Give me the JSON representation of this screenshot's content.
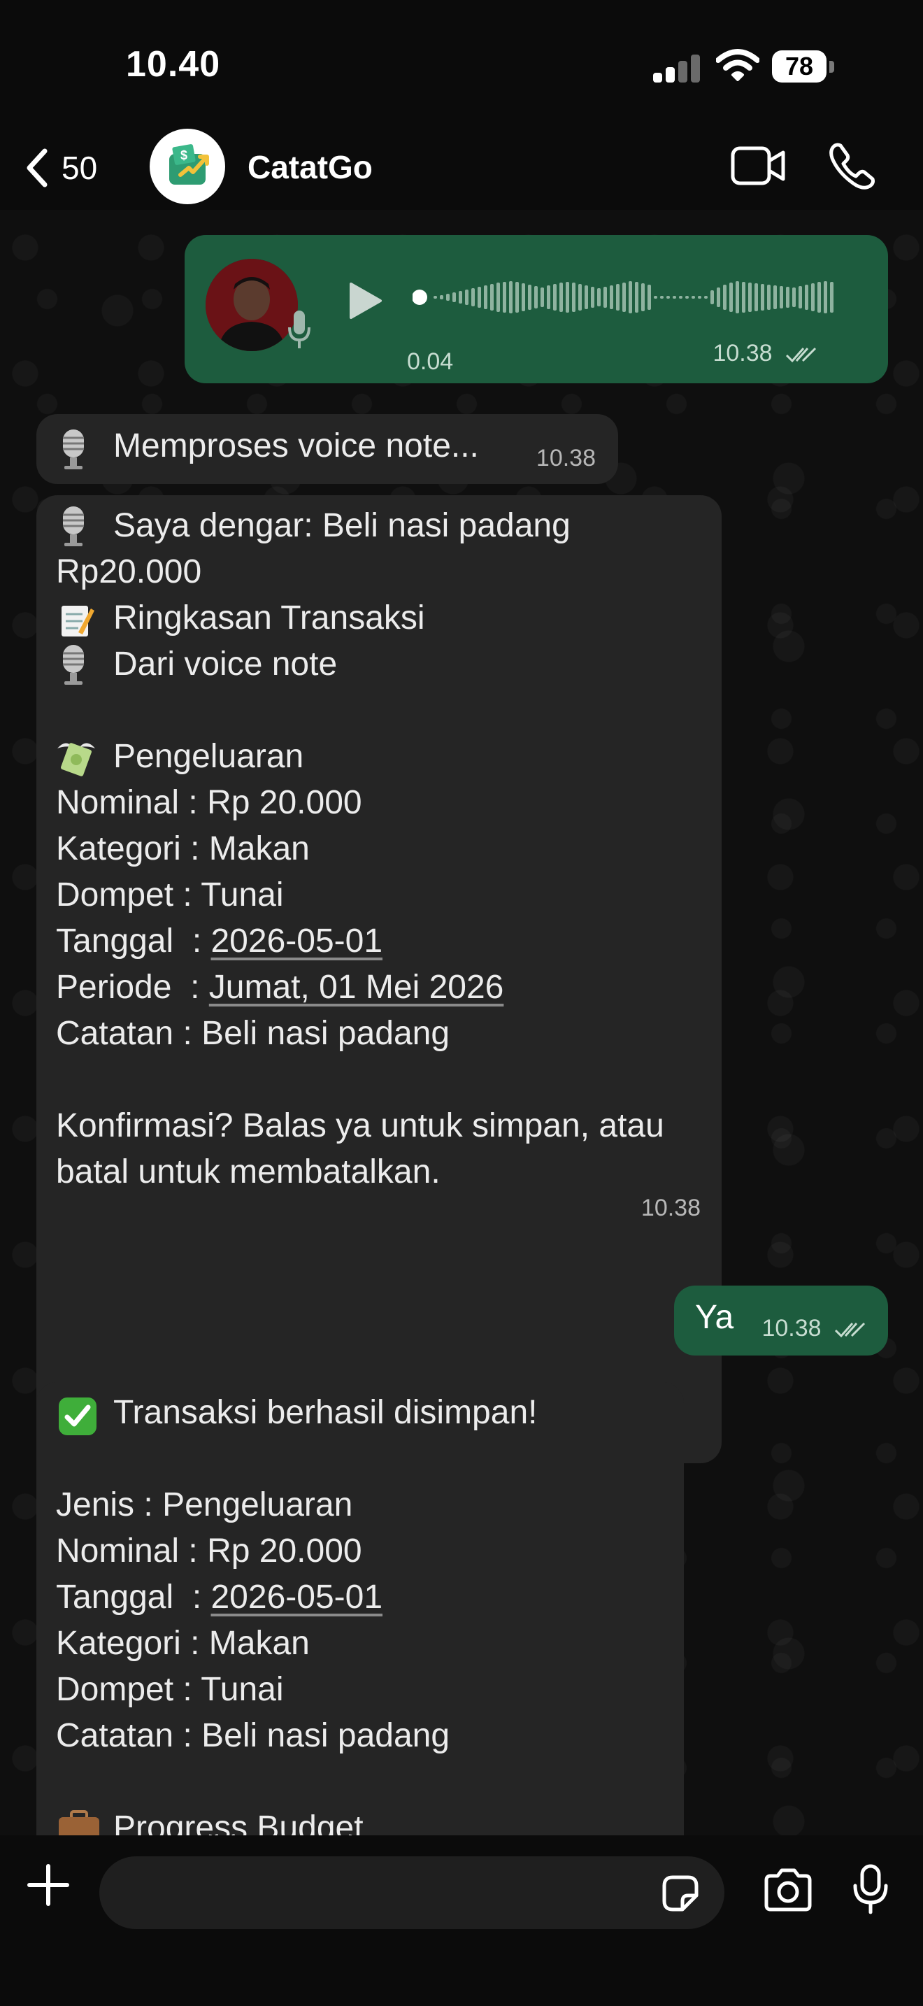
{
  "status_bar": {
    "time": "10.40",
    "battery": "78"
  },
  "header": {
    "back_count": "50",
    "title": "CatatGo"
  },
  "icons": {
    "back": "chevron-left-icon",
    "video": "video-camera-icon",
    "call": "phone-icon",
    "play": "play-icon",
    "mic": "microphone-icon",
    "plus": "plus-icon",
    "sticker": "sticker-icon",
    "camera": "camera-icon",
    "scroll_down": "chevron-down-icon",
    "read": "double-check-icon"
  },
  "colors": {
    "outgoing_bubble": "#1d5c3e",
    "incoming_bubble": "#252525",
    "background": "#0b0b0b"
  },
  "messages": {
    "voice_note": {
      "duration": "0.04",
      "time": "10.38",
      "progress": 0
    },
    "processing": {
      "text": "Memproses voice note...",
      "time": "10.38"
    },
    "summary": {
      "lines": [
        "Saya dengar: Beli nasi padang",
        "Rp20.000",
        "Ringkasan Transaksi",
        "Dari voice note",
        "Pengeluaran",
        "Nominal  : Rp 20.000",
        "Kategori : Makan",
        "Dompet   : Tunai",
        "Tanggal  : ",
        "2026-05-01",
        "Periode  : ",
        "Jumat, 01 Mei 2026",
        "Catatan  : Beli nasi padang",
        "Konfirmasi? Balas ya untuk simpan, atau",
        "batal untuk membatalkan."
      ],
      "time": "10.38"
    },
    "reply": {
      "text": "Ya",
      "time": "10.38"
    },
    "saved": {
      "lines": [
        "Transaksi berhasil disimpan!",
        "Jenis    : Pengeluaran",
        "Nominal  : Rp 20.000",
        "Tanggal  : ",
        "2026-05-01",
        "Kategori : Makan",
        "Dompet   : Tunai",
        "Catatan  : Beli nasi padang",
        "Progress Budget"
      ]
    }
  },
  "input": {
    "placeholder": "",
    "value": ""
  }
}
